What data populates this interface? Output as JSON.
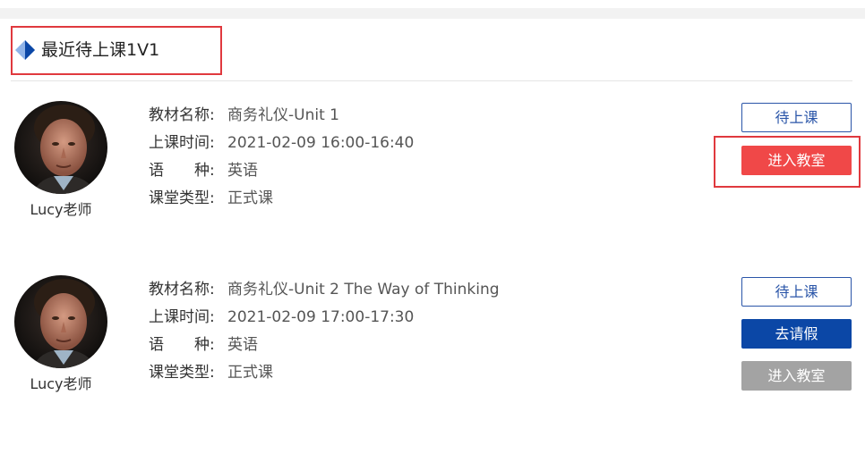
{
  "section": {
    "title": "最近待上课1V1",
    "icon": "diamond-icon",
    "accent": "#2a55a8",
    "highlight_color": "#e0393e"
  },
  "lessons": [
    {
      "teacher": "Lucy老师",
      "rows": [
        {
          "label": "教材名称:",
          "value": "商务礼仪-Unit 1"
        },
        {
          "label": "上课时间:",
          "value": "2021-02-09 16:00-16:40"
        },
        {
          "label": "语　　种:",
          "value": "英语"
        },
        {
          "label": "课堂类型:",
          "value": "正式课"
        }
      ],
      "status_label": "待上课",
      "enter_label": "进入教室"
    },
    {
      "teacher": "Lucy老师",
      "rows": [
        {
          "label": "教材名称:",
          "value": "商务礼仪-Unit 2 The Way of Thinking"
        },
        {
          "label": "上课时间:",
          "value": "2021-02-09 17:00-17:30"
        },
        {
          "label": "语　　种:",
          "value": "英语"
        },
        {
          "label": "课堂类型:",
          "value": "正式课"
        }
      ],
      "status_label": "待上课",
      "leave_label": "去请假",
      "enter_label": "进入教室"
    }
  ],
  "colors": {
    "enter_active": "#f04848",
    "leave": "#0b47a6",
    "enter_disabled": "#a3a3a3",
    "status_border": "#2a55a8"
  }
}
